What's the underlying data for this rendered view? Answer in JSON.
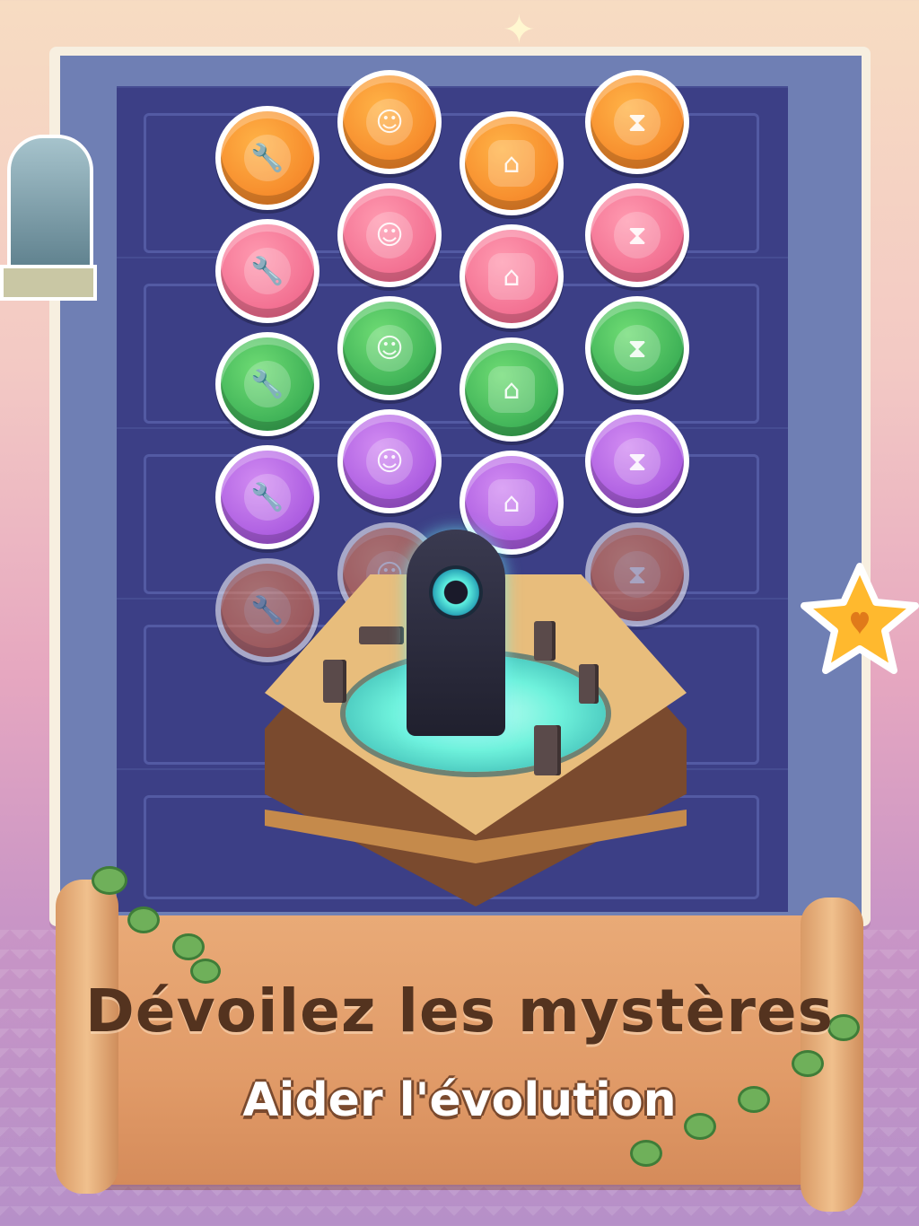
{
  "banner": {
    "title": "Dévoilez les mystères",
    "subtitle": "Aider l'évolution"
  },
  "tokens": {
    "columns": [
      {
        "icon": "wrench-icon",
        "glyph": "🔧",
        "shape": "circle",
        "colors": [
          "orange",
          "pink",
          "green",
          "purple",
          "red"
        ]
      },
      {
        "icon": "person-icon",
        "glyph": "☺",
        "shape": "circle",
        "colors": [
          "orange",
          "pink",
          "green",
          "purple",
          "red"
        ]
      },
      {
        "icon": "house-icon",
        "glyph": "⌂",
        "shape": "oct",
        "colors": [
          "orange",
          "pink",
          "green",
          "purple"
        ]
      },
      {
        "icon": "hourglass-icon",
        "glyph": "⧗",
        "shape": "circle",
        "colors": [
          "orange",
          "pink",
          "green",
          "purple",
          "red"
        ]
      }
    ]
  },
  "colors": {
    "background_top": "#f7dcc2",
    "background_bottom": "#b690c8",
    "board": "#3c3f86",
    "title_text": "#54331f",
    "scroll": "#e9aa77"
  },
  "decor": {
    "sparkle_glyph": "✦",
    "star_glyph": "★"
  }
}
